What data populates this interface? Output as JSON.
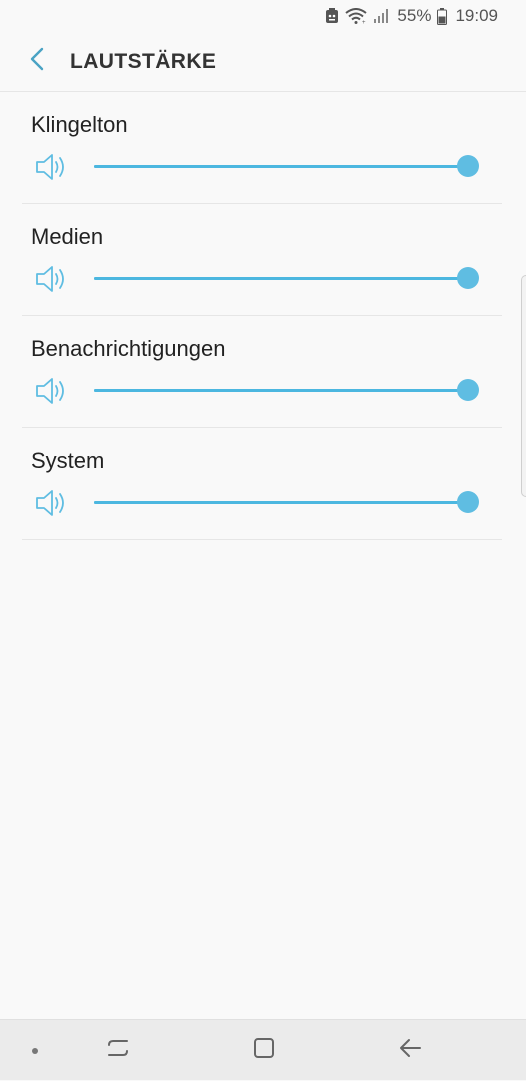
{
  "status_bar": {
    "battery_percent": "55%",
    "time": "19:09",
    "icons": [
      "notification-icon",
      "wifi-icon",
      "signal-icon",
      "battery-icon"
    ]
  },
  "header": {
    "back_icon": "chevron-left-icon",
    "title": "LAUTSTÄRKE"
  },
  "volumes": [
    {
      "label": "Klingelton",
      "icon": "speaker-icon",
      "level": 1.0
    },
    {
      "label": "Medien",
      "icon": "speaker-icon",
      "level": 1.0
    },
    {
      "label": "Benachrichtigungen",
      "icon": "speaker-icon",
      "level": 1.0
    },
    {
      "label": "System",
      "icon": "speaker-icon",
      "level": 1.0
    }
  ],
  "nav_bar": {
    "icons": [
      "dot-icon",
      "recent-apps-icon",
      "home-icon",
      "back-arrow-icon"
    ]
  },
  "colors": {
    "accent": "#5fbde2",
    "title": "#333333",
    "background": "#f9f9f9"
  }
}
